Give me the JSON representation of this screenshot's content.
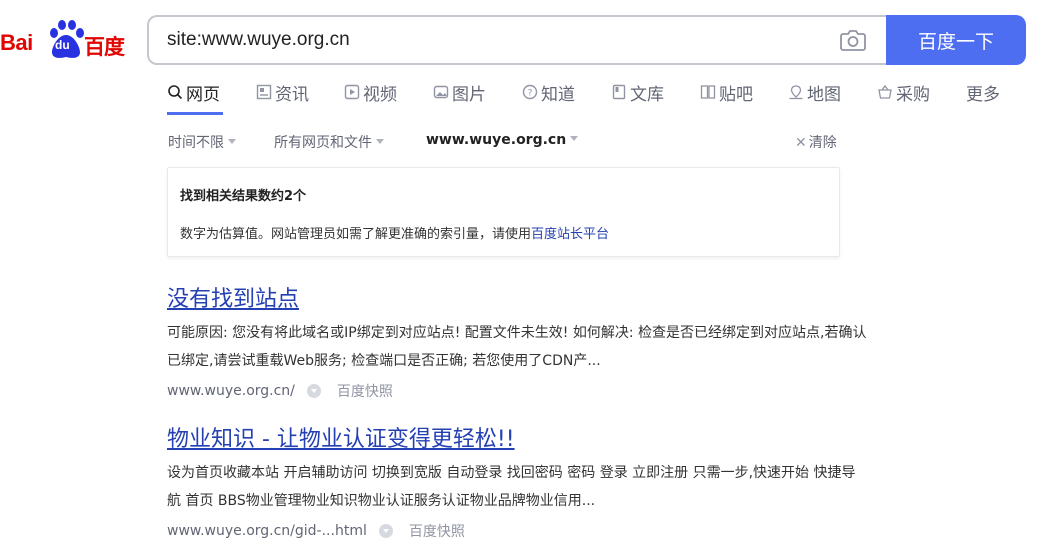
{
  "logo": {
    "bai": "Bai",
    "du": "du",
    "baidu_cn": "百度"
  },
  "search": {
    "query": "site:www.wuye.org.cn",
    "button_label": "百度一下"
  },
  "tabs": [
    {
      "label": "网页",
      "icon": "search-icon",
      "active": true
    },
    {
      "label": "资讯",
      "icon": "news-icon"
    },
    {
      "label": "视频",
      "icon": "video-icon"
    },
    {
      "label": "图片",
      "icon": "image-icon"
    },
    {
      "label": "知道",
      "icon": "question-icon"
    },
    {
      "label": "文库",
      "icon": "doc-icon"
    },
    {
      "label": "贴吧",
      "icon": "tieba-icon"
    },
    {
      "label": "地图",
      "icon": "map-icon"
    },
    {
      "label": "采购",
      "icon": "basket-icon"
    },
    {
      "label": "更多"
    }
  ],
  "filters": {
    "time": "时间不限",
    "filetype": "所有网页和文件",
    "site": "www.wuye.org.cn",
    "clear": "清除"
  },
  "info": {
    "count": "找到相关结果数约2个",
    "desc_prefix": "数字为估算值。网站管理员如需了解更准确的索引量，请使用",
    "link": "百度站长平台"
  },
  "results": [
    {
      "title": "没有找到站点",
      "snippet": "可能原因: 您没有将此域名或IP绑定到对应站点! 配置文件未生效! 如何解决: 检查是否已经绑定到对应站点,若确认已绑定,请尝试重载Web服务; 检查端口是否正确; 若您使用了CDN产...",
      "url": "www.wuye.org.cn/",
      "snapshot": "百度快照"
    },
    {
      "title": "物业知识 - 让物业认证变得更轻松!!",
      "snippet": "设为首页收藏本站 开启辅助访问 切换到宽版 自动登录 找回密码 密码 登录 立即注册 只需一步,快速开始 快捷导航 首页 BBS物业管理物业知识物业认证服务认证物业品牌物业信用...",
      "url": "www.wuye.org.cn/gid-...html",
      "snapshot": "百度快照"
    }
  ],
  "colors": {
    "brand_red": "#e10601",
    "accent_blue": "#4e6ef2",
    "link_blue": "#2440b3"
  }
}
